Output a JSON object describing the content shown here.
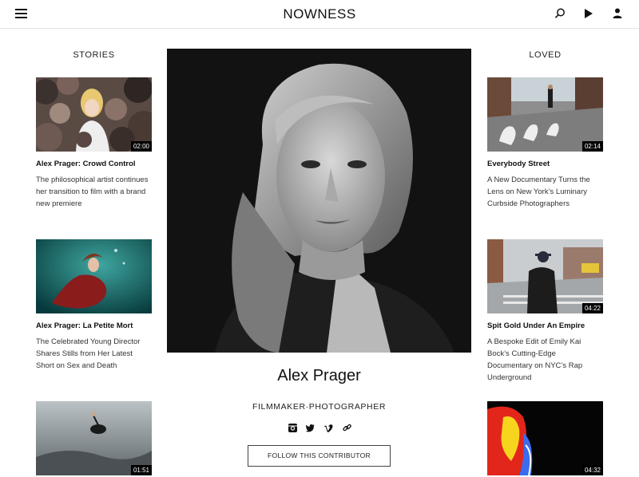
{
  "header": {
    "logo": "NOWNESS",
    "menu_icon": "hamburger-menu-icon",
    "search_icon": "search-icon",
    "play_icon": "play-icon",
    "user_icon": "user-icon"
  },
  "stories": {
    "title": "STORIES",
    "items": [
      {
        "title": "Alex Prager: Crowd Control",
        "desc": "The philosophical artist continues her transition to film with a brand new premiere",
        "duration": "02:00"
      },
      {
        "title": "Alex Prager: La Petite Mort",
        "desc": "The Celebrated Young Director Shares Stills from Her Latest Short on Sex and Death",
        "duration": ""
      },
      {
        "title": "",
        "desc": "",
        "duration": "01:51"
      }
    ]
  },
  "loved": {
    "title": "LOVED",
    "items": [
      {
        "title": "Everybody Street",
        "desc": "A New Documentary Turns the Lens on New York’s Luminary Curbside Photographers",
        "duration": "02:14"
      },
      {
        "title": "Spit Gold Under An Empire",
        "desc": "A Bespoke Edit of Emily Kai Bock’s Cutting-Edge Documentary on NYC’s Rap Underground",
        "duration": "04:22"
      },
      {
        "title": "",
        "desc": "",
        "duration": "04:32"
      }
    ]
  },
  "contributor": {
    "name": "Alex Prager",
    "role": "FILMMAKER·PHOTOGRAPHER",
    "follow_label": "FOLLOW THIS CONTRIBUTOR",
    "social_icons": [
      "instagram-icon",
      "twitter-icon",
      "vimeo-icon",
      "link-icon"
    ]
  },
  "colors": {
    "text": "#111111",
    "badge_bg": "#000000",
    "divider": "#e4e4e4"
  }
}
